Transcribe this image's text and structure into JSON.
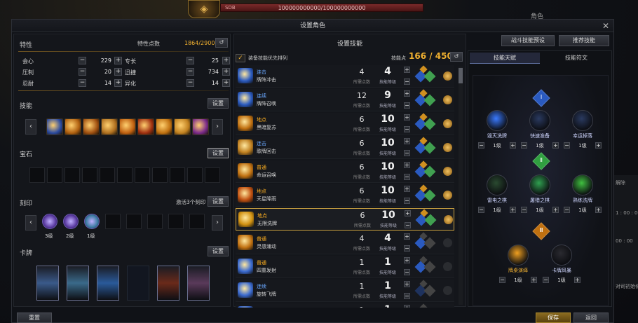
{
  "hud": {
    "hp_label": "SDB",
    "hp_text": "100000000000/100000000000",
    "right_label": "角色"
  },
  "window": {
    "title": "设置角色",
    "close": "✕"
  },
  "traits": {
    "header": "特性",
    "points_label": "特性点数",
    "points_value": "1864/2900",
    "rows": [
      {
        "left_name": "会心",
        "left_val": "229",
        "right_name": "专长",
        "right_val": "25"
      },
      {
        "left_name": "压制",
        "left_val": "20",
        "right_name": "迅捷",
        "right_val": "734"
      },
      {
        "left_name": "忍耐",
        "left_val": "14",
        "right_name": "异化",
        "right_val": "14"
      }
    ]
  },
  "skills_section": {
    "header": "技能",
    "set_label": "设置"
  },
  "gems_section": {
    "header": "宝石",
    "set_label": "设置"
  },
  "engrave_section": {
    "header": "刻印",
    "activate_label": "激活3个刻印",
    "set_label": "设置",
    "items": [
      {
        "level": "3级"
      },
      {
        "level": "2级"
      },
      {
        "level": "1级"
      }
    ]
  },
  "cards_section": {
    "header": "卡牌",
    "set_label": "设置"
  },
  "skill_setup": {
    "title": "设置技能",
    "preset_btn": "战斗技能预设",
    "recommend_btn": "推荐技能",
    "sort_label": "装备技能优先排列",
    "points_label": "技能点",
    "points_value": "166 / 450",
    "pts_sub": "所需点数",
    "lv_sub": "技能等级",
    "skills": [
      {
        "type": "连击",
        "name": "牌阵冲击",
        "pts": "4",
        "lv": "4"
      },
      {
        "type": "连续",
        "name": "牌阵召唤",
        "pts": "12",
        "lv": "9"
      },
      {
        "type": "地点",
        "name": "黑暗复苏",
        "pts": "6",
        "lv": "10"
      },
      {
        "type": "连击",
        "name": "歌牌回击",
        "pts": "6",
        "lv": "10"
      },
      {
        "type": "普通",
        "name": "命运召唤",
        "pts": "6",
        "lv": "10"
      },
      {
        "type": "地点",
        "name": "天星降雨",
        "pts": "6",
        "lv": "10"
      },
      {
        "type": "地点",
        "name": "无限洗牌",
        "pts": "6",
        "lv": "10"
      },
      {
        "type": "普通",
        "name": "灵感涌动",
        "pts": "4",
        "lv": "4"
      },
      {
        "type": "普通",
        "name": "四重发射",
        "pts": "1",
        "lv": "1"
      },
      {
        "type": "连续",
        "name": "旋转飞牌",
        "pts": "1",
        "lv": "1"
      },
      {
        "type": "连击",
        "name": "刺花爆舞",
        "pts": "1",
        "lv": "1"
      }
    ]
  },
  "talent": {
    "tab_talent": "技能天赋",
    "tab_rune": "技能符文",
    "tier1_badge": "Ⅰ",
    "tier2_badge": "Ⅱ",
    "tier3_badge": "Ⅲ",
    "tier1": [
      {
        "name": "毁灭洗牌",
        "lv": "1级"
      },
      {
        "name": "快速准备",
        "lv": "1级"
      },
      {
        "name": "幸运掉落",
        "lv": "1级"
      }
    ],
    "tier2": [
      {
        "name": "雷电之棋",
        "lv": "1级"
      },
      {
        "name": "屠猎之棋",
        "lv": "1级"
      },
      {
        "name": "熟练洗牌",
        "lv": "1级"
      }
    ],
    "tier3": [
      {
        "name": "牌桌演绎",
        "lv": "1级"
      },
      {
        "name": "卡牌风暴",
        "lv": "1级"
      }
    ]
  },
  "footer": {
    "reset": "重置",
    "save": "保存",
    "back": "返回"
  },
  "side": {
    "a": "解除",
    "b": "1 : 00 : 00",
    "c": "00 : 00",
    "d": "对司初始化"
  },
  "colors": {
    "gold": "#f0b030",
    "type_blue": "#6aa8ff",
    "type_orange": "#ffb020",
    "type_green": "#7fd07f"
  }
}
